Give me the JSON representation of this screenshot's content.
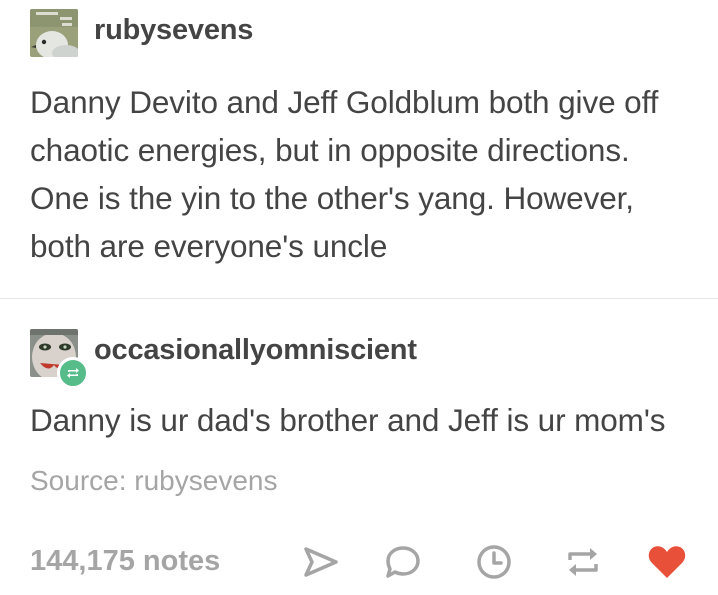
{
  "original_post": {
    "username": "rubysevens",
    "avatar_icon": "pigeon-avatar-icon",
    "text": "Danny Devito and Jeff Goldblum both give off chaotic energies, but in opposite directions. One is the yin to the other's yang. However, both are everyone's uncle"
  },
  "reblog": {
    "username": "occasionallyomniscient",
    "avatar_icon": "face-avatar-icon",
    "badge_icon": "reblog-badge-icon",
    "badge_color": "#56bc8a",
    "text": "Danny is ur dad's brother and Jeff is ur mom's"
  },
  "source": {
    "label": "Source: rubysevens"
  },
  "footer": {
    "notes": "144,175 notes",
    "actions": [
      {
        "name": "share",
        "icon": "send-icon"
      },
      {
        "name": "reply",
        "icon": "chat-bubble-icon"
      },
      {
        "name": "queue",
        "icon": "clock-icon"
      },
      {
        "name": "reblog",
        "icon": "reblog-icon"
      },
      {
        "name": "like",
        "icon": "heart-icon"
      }
    ],
    "icon_color": "#a5a5a5",
    "like_color": "#e8503a"
  }
}
